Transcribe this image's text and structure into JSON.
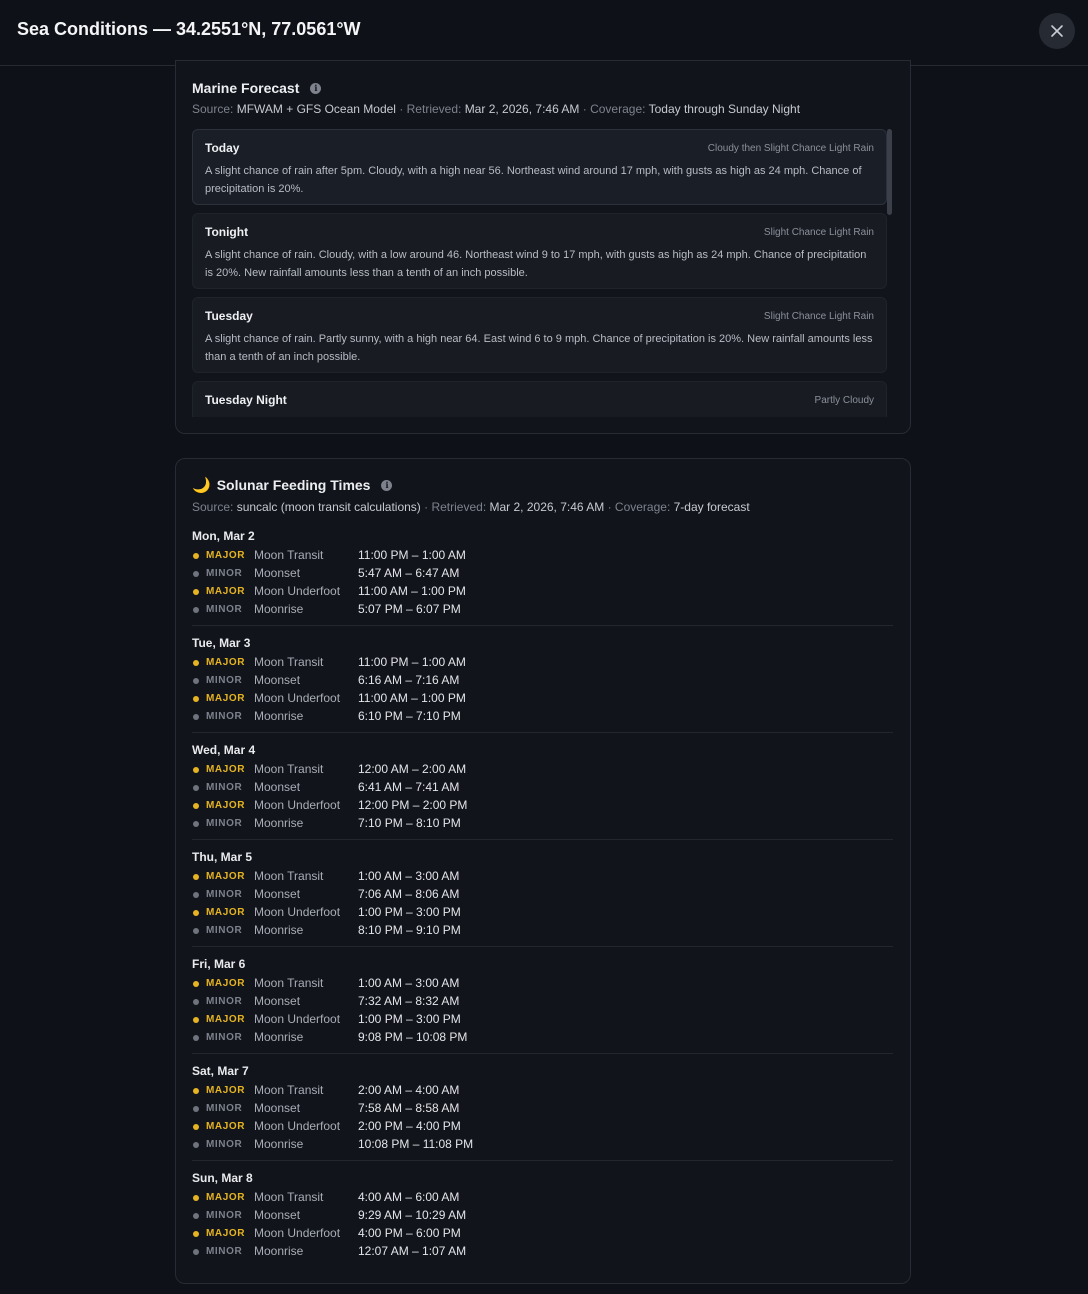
{
  "header": {
    "title": "Sea Conditions — 34.2551°N, 77.0561°W",
    "close_icon": "close-icon"
  },
  "marine": {
    "title": "Marine Forecast",
    "source_label": "Source:",
    "source": "MFWAM + GFS Ocean Model",
    "retrieved_label": "· Retrieved:",
    "retrieved": "Mar 2, 2026, 7:46 AM",
    "coverage_label": "· Coverage:",
    "coverage": "Today through Sunday Night",
    "periods": [
      {
        "name": "Today",
        "short": "Cloudy then Slight Chance Light Rain",
        "text": "A slight chance of rain after 5pm. Cloudy, with a high near 56. Northeast wind around 17 mph, with gusts as high as 24 mph. Chance of precipitation is 20%."
      },
      {
        "name": "Tonight",
        "short": "Slight Chance Light Rain",
        "text": "A slight chance of rain. Cloudy, with a low around 46. Northeast wind 9 to 17 mph, with gusts as high as 24 mph. Chance of precipitation is 20%. New rainfall amounts less than a tenth of an inch possible."
      },
      {
        "name": "Tuesday",
        "short": "Slight Chance Light Rain",
        "text": "A slight chance of rain. Partly sunny, with a high near 64. East wind 6 to 9 mph. Chance of precipitation is 20%. New rainfall amounts less than a tenth of an inch possible."
      },
      {
        "name": "Tuesday Night",
        "short": "Partly Cloudy",
        "text": ""
      }
    ]
  },
  "solunar": {
    "emoji": "🌙",
    "title": "Solunar Feeding Times",
    "source_label": "Source:",
    "source": "suncalc (moon transit calculations)",
    "retrieved_label": "· Retrieved:",
    "retrieved": "Mar 2, 2026, 7:46 AM",
    "coverage_label": "· Coverage:",
    "coverage": "7-day forecast",
    "days": [
      {
        "date": "Mon, Mar 2",
        "events": [
          {
            "kind": "major",
            "badge": "MAJOR",
            "name": "Moon Transit",
            "time": "11:00 PM – 1:00 AM"
          },
          {
            "kind": "minor",
            "badge": "MINOR",
            "name": "Moonset",
            "time": "5:47 AM – 6:47 AM"
          },
          {
            "kind": "major",
            "badge": "MAJOR",
            "name": "Moon Underfoot",
            "time": "11:00 AM – 1:00 PM"
          },
          {
            "kind": "minor",
            "badge": "MINOR",
            "name": "Moonrise",
            "time": "5:07 PM – 6:07 PM"
          }
        ]
      },
      {
        "date": "Tue, Mar 3",
        "events": [
          {
            "kind": "major",
            "badge": "MAJOR",
            "name": "Moon Transit",
            "time": "11:00 PM – 1:00 AM"
          },
          {
            "kind": "minor",
            "badge": "MINOR",
            "name": "Moonset",
            "time": "6:16 AM – 7:16 AM"
          },
          {
            "kind": "major",
            "badge": "MAJOR",
            "name": "Moon Underfoot",
            "time": "11:00 AM – 1:00 PM"
          },
          {
            "kind": "minor",
            "badge": "MINOR",
            "name": "Moonrise",
            "time": "6:10 PM – 7:10 PM"
          }
        ]
      },
      {
        "date": "Wed, Mar 4",
        "events": [
          {
            "kind": "major",
            "badge": "MAJOR",
            "name": "Moon Transit",
            "time": "12:00 AM – 2:00 AM"
          },
          {
            "kind": "minor",
            "badge": "MINOR",
            "name": "Moonset",
            "time": "6:41 AM – 7:41 AM"
          },
          {
            "kind": "major",
            "badge": "MAJOR",
            "name": "Moon Underfoot",
            "time": "12:00 PM – 2:00 PM"
          },
          {
            "kind": "minor",
            "badge": "MINOR",
            "name": "Moonrise",
            "time": "7:10 PM – 8:10 PM"
          }
        ]
      },
      {
        "date": "Thu, Mar 5",
        "events": [
          {
            "kind": "major",
            "badge": "MAJOR",
            "name": "Moon Transit",
            "time": "1:00 AM – 3:00 AM"
          },
          {
            "kind": "minor",
            "badge": "MINOR",
            "name": "Moonset",
            "time": "7:06 AM – 8:06 AM"
          },
          {
            "kind": "major",
            "badge": "MAJOR",
            "name": "Moon Underfoot",
            "time": "1:00 PM – 3:00 PM"
          },
          {
            "kind": "minor",
            "badge": "MINOR",
            "name": "Moonrise",
            "time": "8:10 PM – 9:10 PM"
          }
        ]
      },
      {
        "date": "Fri, Mar 6",
        "events": [
          {
            "kind": "major",
            "badge": "MAJOR",
            "name": "Moon Transit",
            "time": "1:00 AM – 3:00 AM"
          },
          {
            "kind": "minor",
            "badge": "MINOR",
            "name": "Moonset",
            "time": "7:32 AM – 8:32 AM"
          },
          {
            "kind": "major",
            "badge": "MAJOR",
            "name": "Moon Underfoot",
            "time": "1:00 PM – 3:00 PM"
          },
          {
            "kind": "minor",
            "badge": "MINOR",
            "name": "Moonrise",
            "time": "9:08 PM – 10:08 PM"
          }
        ]
      },
      {
        "date": "Sat, Mar 7",
        "events": [
          {
            "kind": "major",
            "badge": "MAJOR",
            "name": "Moon Transit",
            "time": "2:00 AM – 4:00 AM"
          },
          {
            "kind": "minor",
            "badge": "MINOR",
            "name": "Moonset",
            "time": "7:58 AM – 8:58 AM"
          },
          {
            "kind": "major",
            "badge": "MAJOR",
            "name": "Moon Underfoot",
            "time": "2:00 PM – 4:00 PM"
          },
          {
            "kind": "minor",
            "badge": "MINOR",
            "name": "Moonrise",
            "time": "10:08 PM – 11:08 PM"
          }
        ]
      },
      {
        "date": "Sun, Mar 8",
        "events": [
          {
            "kind": "major",
            "badge": "MAJOR",
            "name": "Moon Transit",
            "time": "4:00 AM – 6:00 AM"
          },
          {
            "kind": "minor",
            "badge": "MINOR",
            "name": "Moonset",
            "time": "9:29 AM – 10:29 AM"
          },
          {
            "kind": "major",
            "badge": "MAJOR",
            "name": "Moon Underfoot",
            "time": "4:00 PM – 6:00 PM"
          },
          {
            "kind": "minor",
            "badge": "MINOR",
            "name": "Moonrise",
            "time": "12:07 AM – 1:07 AM"
          }
        ]
      }
    ]
  },
  "colors": {
    "major": "#e6b422",
    "minor": "#6e737d",
    "background": "#0e1117"
  }
}
